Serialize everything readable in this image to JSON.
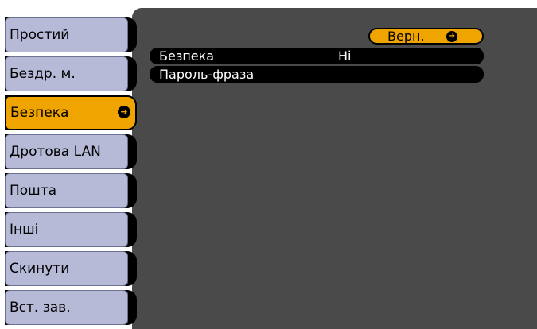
{
  "sidebar": {
    "items": [
      {
        "label": "Простий"
      },
      {
        "label": "Бездр. м."
      },
      {
        "label": "Безпека",
        "active": true,
        "enter_icon": "enter-icon"
      },
      {
        "label": "Дротова LAN"
      },
      {
        "label": "Пошта"
      },
      {
        "label": "Інші"
      },
      {
        "label": "Скинути"
      },
      {
        "label": "Вст. зав."
      }
    ]
  },
  "main": {
    "back_label": "Верн.",
    "rows": [
      {
        "label": "Безпека",
        "value": "Ні"
      },
      {
        "label": "Пароль-фраза",
        "value": ""
      }
    ]
  },
  "colors": {
    "accent": "#f0a400",
    "tab": "#b6bad7",
    "panel": "#4a4a4a",
    "row": "#000000"
  }
}
